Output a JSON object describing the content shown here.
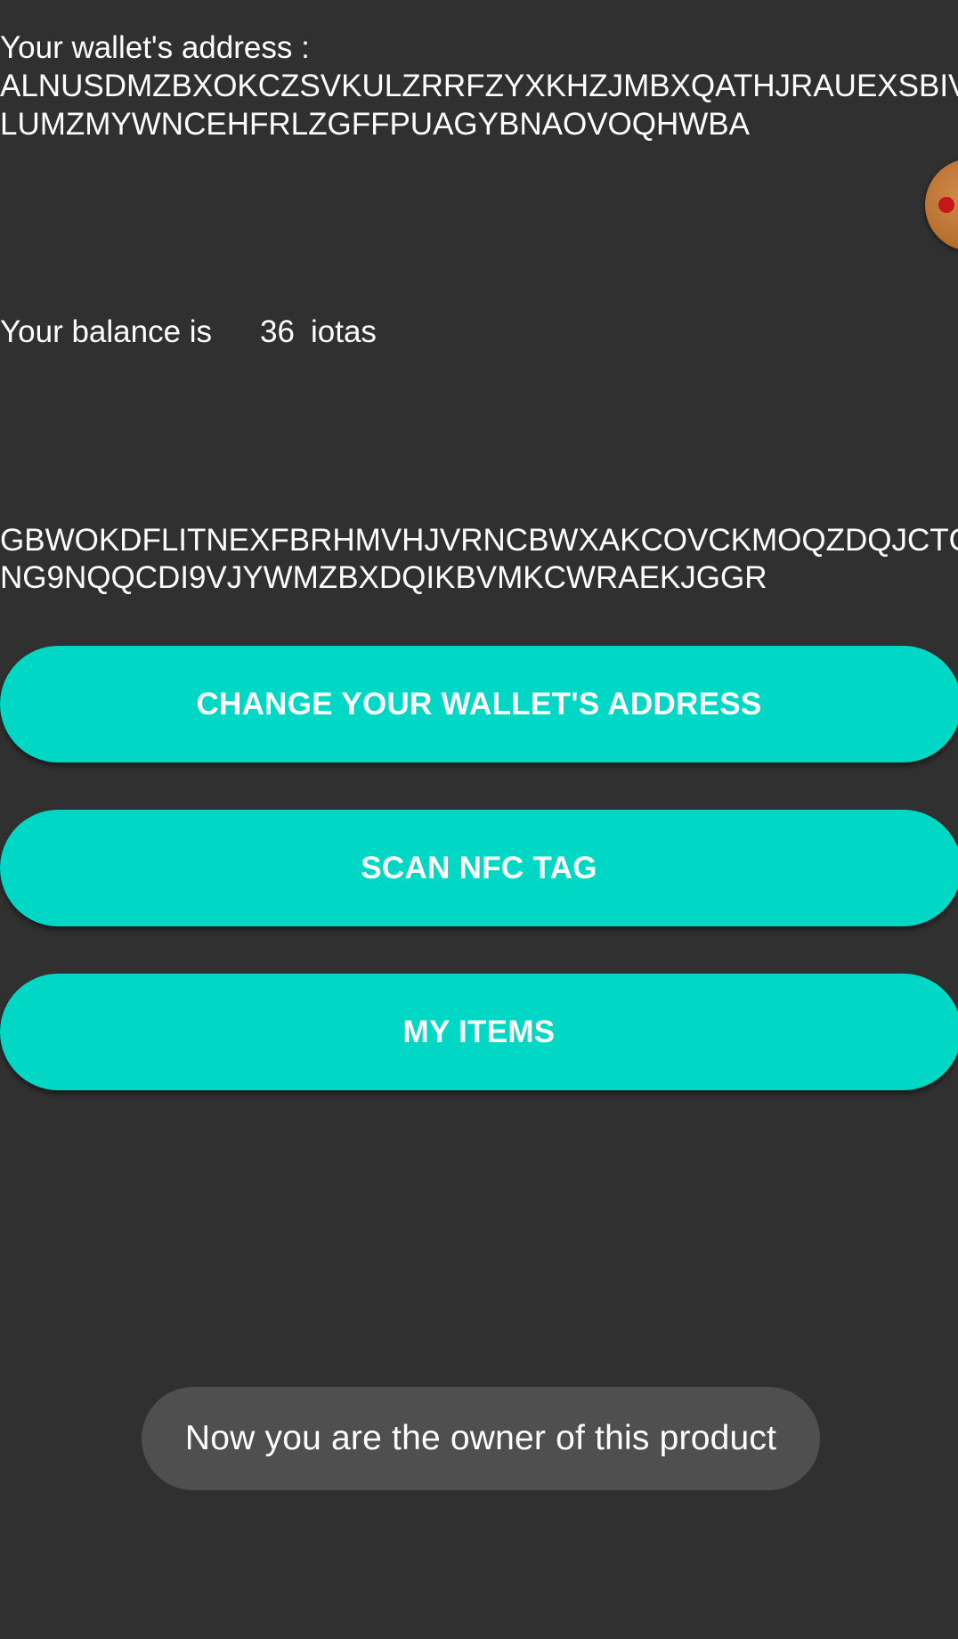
{
  "wallet": {
    "label": "Your wallet's address :",
    "address_line1": "ALNUSDMZBXOKCZSVKULZRRFZYXKHZJMBXQATHJRAUEXSBIV",
    "address_line2": "LUMZMYWNCEHFRLZGFFPUAGYBNAOVOQHWBA"
  },
  "balance": {
    "label": "Your balance is",
    "value": "36",
    "unit": "iotas"
  },
  "nfc_tag": {
    "line1": "GBWOKDFLITNEXFBRHMVHJVRNCBWXAKCOVCKMOQZDQJCTG",
    "line2": "NG9NQQCDI9VJYWMZBXDQIKBVMKCWRAEKJGGR"
  },
  "buttons": {
    "change_address": "CHANGE YOUR WALLET'S ADDRESS",
    "scan_nfc": "SCAN NFC TAG",
    "my_items": "MY ITEMS"
  },
  "toast": {
    "message": "Now you are the owner of this product"
  },
  "colors": {
    "background": "#303030",
    "button": "#00d7c4",
    "toast": "#4f4f4f",
    "text": "#ffffff"
  },
  "icons": {
    "floating_bubble": "chat-head-bubble-icon"
  }
}
